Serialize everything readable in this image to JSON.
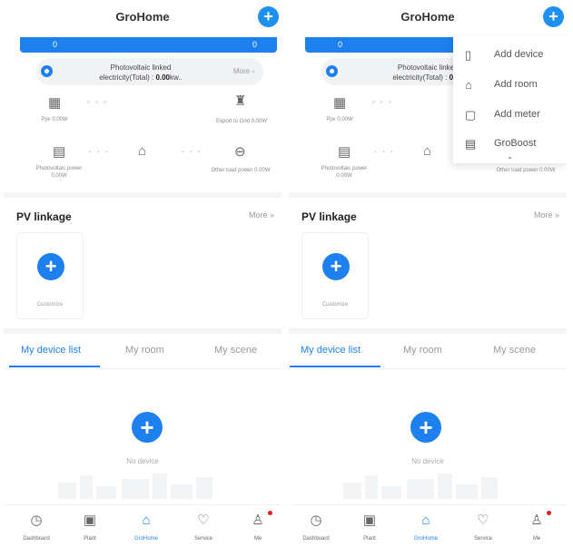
{
  "app": {
    "title": "GroHome",
    "add_symbol": "+"
  },
  "energy_bar": {
    "left_value": "0",
    "right_value": "0"
  },
  "pv_summary": {
    "line1": "Photovoltaic linked",
    "line2_prefix": "electricity(Total) :",
    "line2_value": "0.00",
    "line2_unit": "kw..",
    "line1_cut": "Photovoltaic linke",
    "line2_prefix_cut": "electricity(Total) :",
    "line2_value_cut": "0.0",
    "more_label": "More",
    "more_arrow": "›"
  },
  "flow": {
    "pv_label": "Ppv 0.00W",
    "export_label": "Export to Grid 0.00W",
    "pv_power_label": "Photovoltaic power",
    "pv_power_value": "0.00W",
    "other_load_label": "Other load power 0.00W",
    "dots": "• • •"
  },
  "pv_linkage": {
    "title": "PV linkage",
    "more_label": "More",
    "more_arrow": "»",
    "card_label": "Customize"
  },
  "tabs": [
    {
      "label": "My device list",
      "active": true
    },
    {
      "label": "My room",
      "active": false
    },
    {
      "label": "My scene",
      "active": false
    }
  ],
  "empty_state": {
    "text": "No device",
    "plus": "+"
  },
  "bottom_nav": [
    {
      "label": "Dashboard",
      "icon": "dashboard-icon",
      "glyph": "◷",
      "active": false
    },
    {
      "label": "Plant",
      "icon": "plant-icon",
      "glyph": "▣",
      "active": false
    },
    {
      "label": "GroHome",
      "icon": "home-icon",
      "glyph": "⌂",
      "active": true
    },
    {
      "label": "Service",
      "icon": "service-icon",
      "glyph": "♡",
      "active": false
    },
    {
      "label": "Me",
      "icon": "person-icon",
      "glyph": "♙",
      "active": false,
      "badge": true
    }
  ],
  "add_menu": {
    "items": [
      {
        "label": "Add device",
        "icon": "device-icon",
        "glyph": "▯"
      },
      {
        "label": "Add room",
        "icon": "room-icon",
        "glyph": "⌂"
      },
      {
        "label": "Add meter",
        "icon": "meter-icon",
        "glyph": "▢"
      },
      {
        "label": "GroBoost",
        "icon": "groboost-icon",
        "glyph": "▤"
      }
    ],
    "caret": "⌄"
  },
  "colors": {
    "accent": "#1e80ee",
    "badge": "#e02020",
    "divider": "#f4f5f7"
  }
}
